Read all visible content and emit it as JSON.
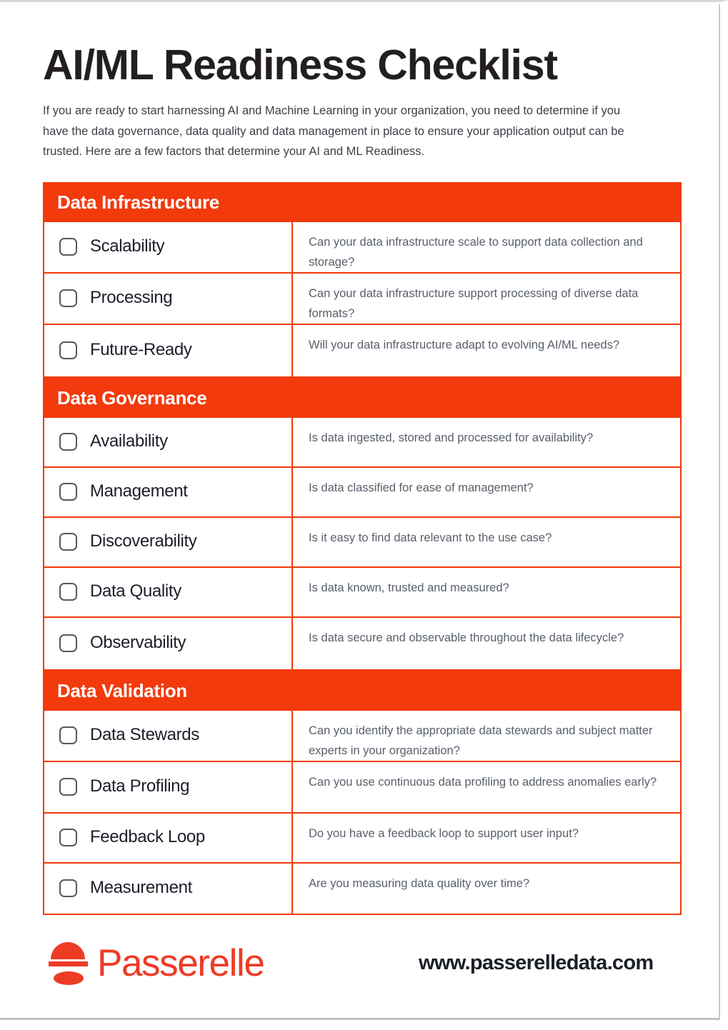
{
  "document": {
    "title": "AI/ML Readiness Checklist",
    "intro": "If you are ready to start harnessing AI and Machine Learning in your organization, you need to determine if you have the data governance, data quality and data management in place to ensure your application output can be trusted. Here are a few factors that determine your AI and ML Readiness."
  },
  "colors": {
    "accent": "#F23A0C",
    "brand": "#EE3B24",
    "title_text": "#231f20",
    "question_text": "#585f6b",
    "label_text": "#1b1f2a",
    "checkbox_border": "#55595f"
  },
  "sections": [
    {
      "title": "Data Infrastructure",
      "items": [
        {
          "label": "Scalability",
          "question": "Can your data infrastructure scale to support data collection and storage?"
        },
        {
          "label": "Processing",
          "question": "Can your data infrastructure support processing of diverse data formats?"
        },
        {
          "label": "Future-Ready",
          "question": "Will your data infrastructure adapt to evolving AI/ML needs?"
        }
      ]
    },
    {
      "title": "Data Governance",
      "items": [
        {
          "label": "Availability",
          "question": "Is data ingested, stored and processed for availability?"
        },
        {
          "label": "Management",
          "question": "Is data classified for ease of management?"
        },
        {
          "label": "Discoverability",
          "question": "Is it easy to find data relevant to the use case?"
        },
        {
          "label": "Data Quality",
          "question": "Is data known, trusted and measured?"
        },
        {
          "label": "Observability",
          "question": "Is data secure and observable throughout the data lifecycle?"
        }
      ]
    },
    {
      "title": "Data Validation",
      "items": [
        {
          "label": "Data Stewards",
          "question": "Can you identify the appropriate data stewards and subject matter experts in your organization?"
        },
        {
          "label": "Data Profiling",
          "question": "Can you use continuous data profiling to address anomalies early?"
        },
        {
          "label": "Feedback Loop",
          "question": "Do you have a feedback loop to support user input?"
        },
        {
          "label": "Measurement",
          "question": "Are you measuring data quality over time?"
        }
      ]
    }
  ],
  "footer": {
    "brand_name": "Passerelle",
    "brand_mark": "passerelle-bridge-icon",
    "url": "www.passerelledata.com"
  }
}
